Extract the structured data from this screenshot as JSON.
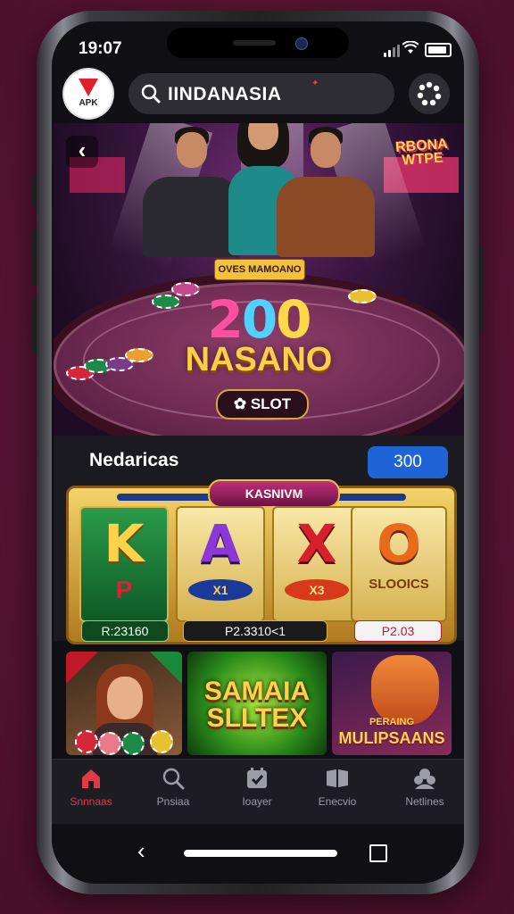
{
  "status": {
    "time": "19:07"
  },
  "app": {
    "badge_label": "APK"
  },
  "search": {
    "text": "IINDANASIA"
  },
  "hero": {
    "bonus_line1": "RBONA",
    "bonus_line2": "WTPE",
    "table_sign": "OVES MAMOANO",
    "amount": [
      "2",
      "0",
      "0"
    ],
    "title": "NASANO",
    "slot_button": "SLOT"
  },
  "section": {
    "title": "Nedaricas",
    "badge_value": "300",
    "machine_tab": "KASNIVM",
    "reels": [
      {
        "symbol": "K",
        "sub": "P",
        "pill": "R:23160"
      },
      {
        "symbol": "A",
        "sub": "X1",
        "pill": "P2.3310<1"
      },
      {
        "symbol": "X",
        "sub": "X3",
        "pill": ""
      },
      {
        "symbol": "O",
        "sub": "SLOOICS",
        "pill": "P2.03"
      }
    ]
  },
  "thumbs": [
    {
      "label": ""
    },
    {
      "line1": "SAMAIA",
      "line2": "SLLTEX"
    },
    {
      "line1": "PERAING",
      "line2": "MULIPSAANS"
    }
  ],
  "nav": {
    "items": [
      {
        "label": "Snnnaas",
        "icon": "home-icon",
        "active": true
      },
      {
        "label": "Pnsiaa",
        "icon": "search-icon",
        "active": false
      },
      {
        "label": "Ioayer",
        "icon": "calendar-icon",
        "active": false
      },
      {
        "label": "Enecvio",
        "icon": "book-icon",
        "active": false
      },
      {
        "label": "Netlines",
        "icon": "people-icon",
        "active": false
      }
    ]
  },
  "colors": {
    "accent": "#e03a4a",
    "badge": "#1f64d6",
    "background": "#5e1737"
  }
}
